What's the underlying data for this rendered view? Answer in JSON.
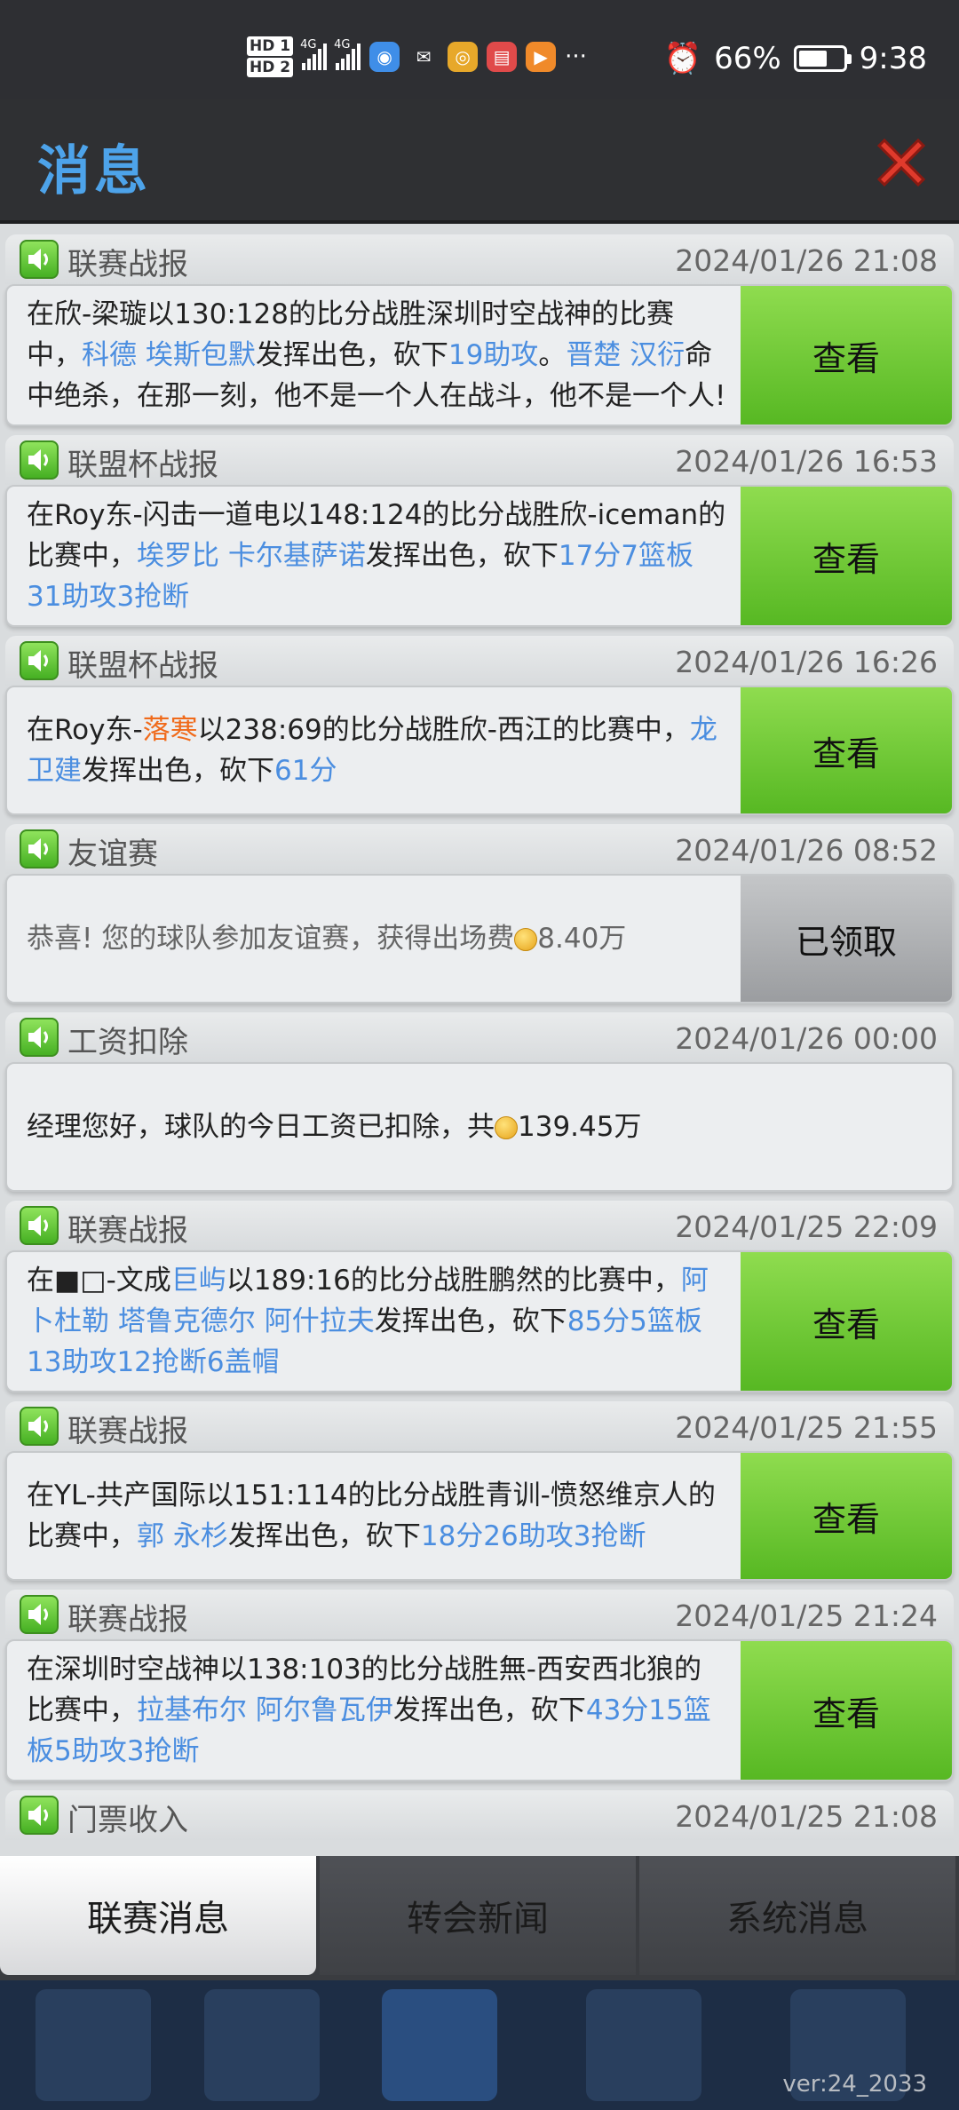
{
  "status_bar": {
    "hd1": "HD 1",
    "hd2": "HD 2",
    "net1": "4G",
    "net2": "4G",
    "battery_percent": "66%",
    "battery_level": 0.66,
    "time": "9:38",
    "dots": "···"
  },
  "header": {
    "title": "消息"
  },
  "messages": [
    {
      "type": "联赛战报",
      "time": "2024/01/26 21:08",
      "parts": [
        {
          "t": "在欣-梁璇以130:128的比分战胜深圳时空战神的比赛中，"
        },
        {
          "t": "科德 埃斯包默",
          "c": "hl"
        },
        {
          "t": "发挥出色，砍下"
        },
        {
          "t": "19助攻",
          "c": "hl"
        },
        {
          "t": "。"
        },
        {
          "t": "晋楚 汉衍",
          "c": "hl"
        },
        {
          "t": "命中绝杀，在那一刻，他不是一个人在战斗，他不是一个人!"
        }
      ],
      "button": "查看",
      "button_style": "view",
      "height": 160
    },
    {
      "type": "联盟杯战报",
      "time": "2024/01/26 16:53",
      "parts": [
        {
          "t": "在Roy东-闪击一道电以148:124的比分战胜欣-iceman的比赛中，"
        },
        {
          "t": "埃罗比 卡尔基萨诺",
          "c": "hl"
        },
        {
          "t": "发挥出色，砍下"
        },
        {
          "t": "17分7篮板31助攻3抢断",
          "c": "hl"
        }
      ],
      "button": "查看",
      "button_style": "view",
      "height": 160
    },
    {
      "type": "联盟杯战报",
      "time": "2024/01/26 16:26",
      "parts": [
        {
          "t": "在Roy东-"
        },
        {
          "t": "落寒",
          "c": "or"
        },
        {
          "t": "以238:69的比分战胜欣-西江的比赛中，"
        },
        {
          "t": "龙 卫建",
          "c": "hl"
        },
        {
          "t": "发挥出色，砍下"
        },
        {
          "t": "61分",
          "c": "hl"
        }
      ],
      "button": "查看",
      "button_style": "view",
      "height": 146
    },
    {
      "type": "友谊赛",
      "time": "2024/01/26 08:52",
      "parts": [
        {
          "t": "恭喜!  您的球队参加友谊赛，获得出场费"
        },
        {
          "coin": true
        },
        {
          "t": "8.40万"
        }
      ],
      "button": "已领取",
      "button_style": "done",
      "height": 146,
      "gray": true
    },
    {
      "type": "工资扣除",
      "time": "2024/01/26 00:00",
      "parts": [
        {
          "t": "经理您好，球队的今日工资已扣除，共"
        },
        {
          "coin": true
        },
        {
          "t": "139.45万"
        }
      ],
      "button": "",
      "height": 146
    },
    {
      "type": "联赛战报",
      "time": "2024/01/25 22:09",
      "parts": [
        {
          "t": "在■□-文成"
        },
        {
          "t": "巨屿",
          "c": "hl"
        },
        {
          "t": "以189:16的比分战胜鹏然的比赛中，"
        },
        {
          "t": "阿卜杜勒 塔鲁克德尔 阿什拉夫",
          "c": "hl"
        },
        {
          "t": "发挥出色，砍下"
        },
        {
          "t": "85分5篮板13助攻12抢断6盖帽",
          "c": "hl"
        }
      ],
      "button": "查看",
      "button_style": "view",
      "height": 160
    },
    {
      "type": "联赛战报",
      "time": "2024/01/25 21:55",
      "parts": [
        {
          "t": "在YL-共产国际以151:114的比分战胜青训-愤怒维京人的比赛中，"
        },
        {
          "t": "郭 永杉",
          "c": "hl"
        },
        {
          "t": "发挥出色，砍下"
        },
        {
          "t": "18分26助攻3抢断",
          "c": "hl"
        }
      ],
      "button": "查看",
      "button_style": "view",
      "height": 146
    },
    {
      "type": "联赛战报",
      "time": "2024/01/25 21:24",
      "parts": [
        {
          "t": "在深圳时空战神以138:103的比分战胜無-西安西北狼的比赛中，"
        },
        {
          "t": "拉基布尔 阿尔鲁瓦伊",
          "c": "hl"
        },
        {
          "t": "发挥出色，砍下"
        },
        {
          "t": "43分15篮板5助攻3抢断",
          "c": "hl"
        }
      ],
      "button": "查看",
      "button_style": "view",
      "height": 160
    },
    {
      "type": "门票收入",
      "time": "2024/01/25 21:08",
      "parts": [],
      "button": "",
      "height": 60
    }
  ],
  "tabs": [
    "联赛消息",
    "转会新闻",
    "系统消息"
  ],
  "version": "ver:24_2033"
}
